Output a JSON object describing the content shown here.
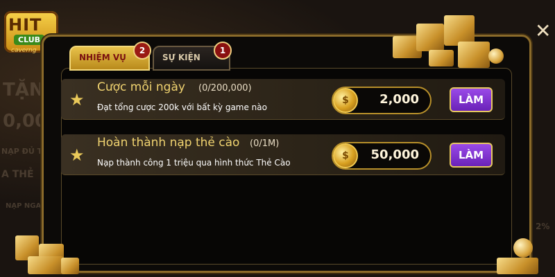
{
  "brand": {
    "logo_main": "HIT",
    "logo_sub": "CLUB",
    "logo_domain": "caverng"
  },
  "background": {
    "text_1": "TẶN",
    "text_2": "0,00",
    "text_3": "NẠP ĐỦ T",
    "text_4": "A THẺ",
    "text_5": "NẠP NGA",
    "text_6": "2%"
  },
  "tabs": [
    {
      "label": "NHIỆM VỤ",
      "badge": "2",
      "active": true
    },
    {
      "label": "SỰ KIỆN",
      "badge": "1",
      "active": false
    }
  ],
  "tasks": [
    {
      "title": "Cược mỗi ngày",
      "progress": "(0/200,000)",
      "description": "Đạt tổng cược 200k với bất kỳ game nào",
      "reward": "2,000",
      "button": "LÀM"
    },
    {
      "title": "Hoàn thành nạp thẻ cào",
      "progress": "(0/1M)",
      "description": "Nạp thành công 1 triệu qua hình thức Thẻ Cào",
      "reward": "50,000",
      "button": "LÀM"
    }
  ],
  "icons": {
    "task": "star-icon",
    "reward": "coin-icon",
    "close": "close-icon"
  },
  "colors": {
    "accent_gold": "#e8c24a",
    "button_purple": "#7a2fcf",
    "tab_badge_red": "#9a1a14"
  }
}
